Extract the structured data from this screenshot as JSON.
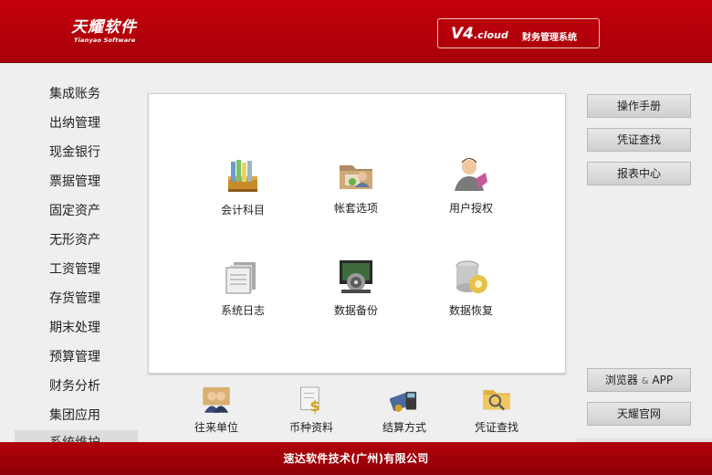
{
  "brand": {
    "name_cn": "天耀软件",
    "name_en": "Tianyao Software"
  },
  "version": {
    "label": "V4",
    "suffix": ".cloud",
    "system_name": "财务管理系统"
  },
  "left_menu": [
    "集成账务",
    "出纳管理",
    "现金银行",
    "票据管理",
    "固定资产",
    "无形资产",
    "工资管理",
    "存货管理",
    "期末处理",
    "预算管理",
    "财务分析",
    "集团应用"
  ],
  "left_menu_partial": "系统维护",
  "tiles": [
    {
      "label": "会计科目",
      "icon": "books-icon"
    },
    {
      "label": "帐套选项",
      "icon": "folder-user-icon"
    },
    {
      "label": "用户授权",
      "icon": "user-authorize-icon"
    },
    {
      "label": "系统日志",
      "icon": "log-files-icon"
    },
    {
      "label": "数据备份",
      "icon": "monitor-backup-icon"
    },
    {
      "label": "数据恢复",
      "icon": "database-restore-icon"
    }
  ],
  "bottom_tiles": [
    {
      "label": "往来单位",
      "icon": "partners-icon"
    },
    {
      "label": "币种资料",
      "icon": "currency-icon"
    },
    {
      "label": "结算方式",
      "icon": "settlement-card-icon"
    },
    {
      "label": "凭证查找",
      "icon": "voucher-search-icon"
    }
  ],
  "right_buttons": {
    "manual": "操作手册",
    "voucher_search": "凭证查找",
    "report_center": "报表中心",
    "browser_prefix": "浏览器",
    "browser_amp": "&",
    "browser_suffix": "APP",
    "website": "天耀官网"
  },
  "footer": "速达软件技术(广州)有限公司",
  "colors": {
    "brand_red": "#b3000a",
    "panel_bg": "#ffffff",
    "page_bg": "#efefef"
  }
}
